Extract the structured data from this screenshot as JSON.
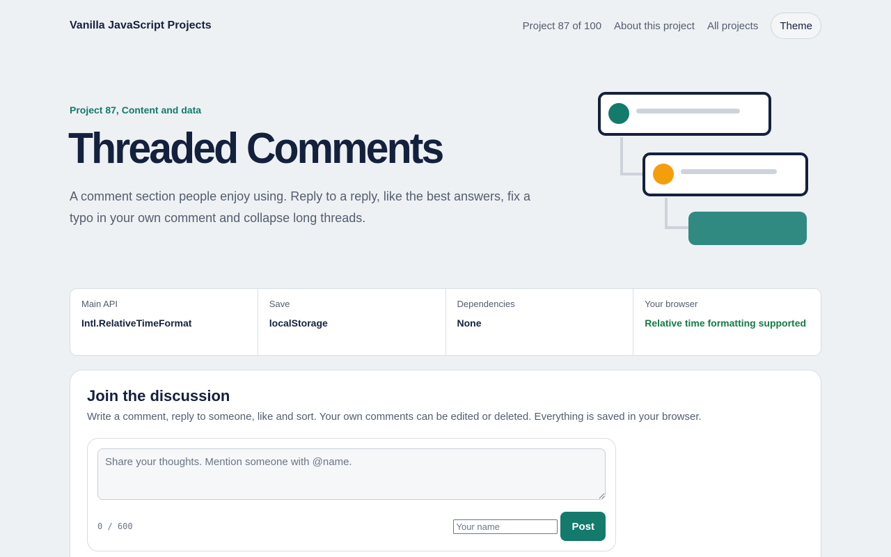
{
  "header": {
    "brand": "Vanilla JavaScript Projects",
    "nav": {
      "progress": "Project 87 of 100",
      "about": "About this project",
      "all": "All projects",
      "theme": "Theme"
    }
  },
  "hero": {
    "kicker": "Project 87, Content and data",
    "title": "Threaded Comments",
    "description": "A comment section people enjoy using. Reply to a reply, like the best answers, fix a typo in your own comment and collapse long threads."
  },
  "info": [
    {
      "label": "Main API",
      "value": "Intl.RelativeTimeFormat"
    },
    {
      "label": "Save",
      "value": "localStorage"
    },
    {
      "label": "Dependencies",
      "value": "None"
    },
    {
      "label": "Your browser",
      "value": "Relative time formatting supported"
    }
  ],
  "discussion": {
    "title": "Join the discussion",
    "subtitle": "Write a comment, reply to someone, like and sort. Your own comments can be edited or deleted. Everything is saved in your browser.",
    "textarea_placeholder": "Share your thoughts. Mention someone with @name.",
    "counter": "0 / 600",
    "name_placeholder": "Your name",
    "post_label": "Post"
  },
  "colors": {
    "accent": "#137a6c",
    "avatar_teal": "#137a6c",
    "avatar_orange": "#f59e0b",
    "success": "#137a45",
    "text_dark": "#14213d"
  }
}
